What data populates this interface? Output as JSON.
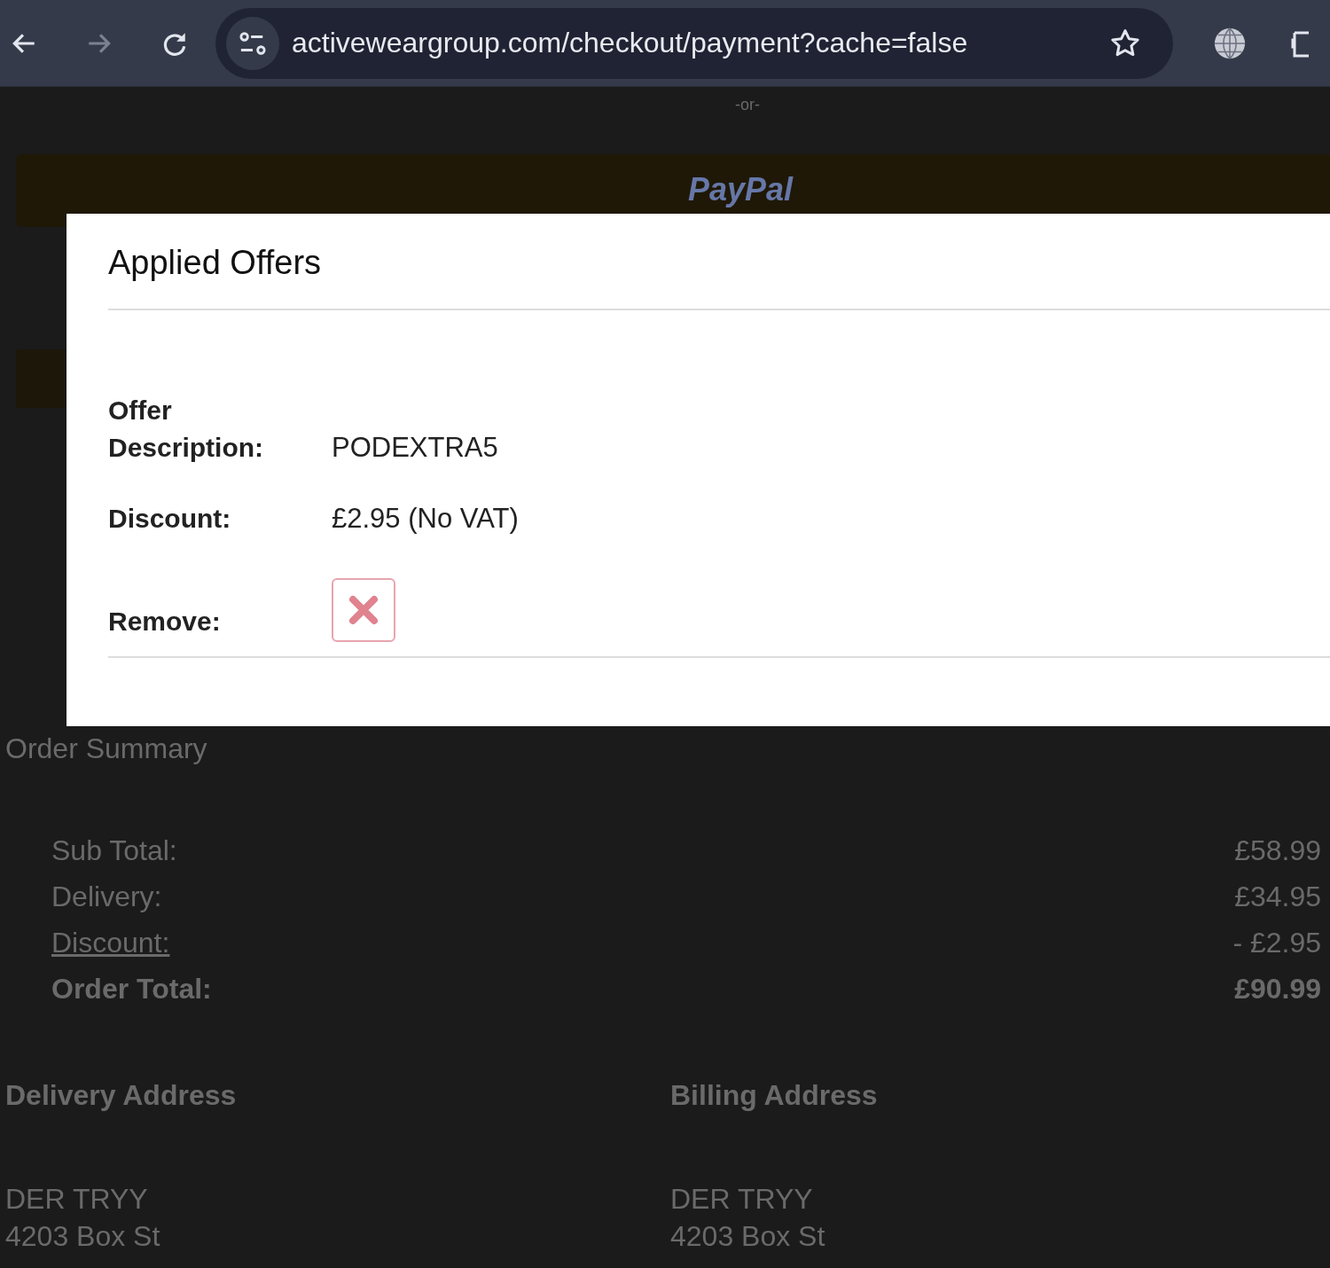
{
  "browser": {
    "url": "activeweargroup.com/checkout/payment?cache=false"
  },
  "page": {
    "separator": "-or-",
    "paypal": "PayPal",
    "order_summary": {
      "title": "Order Summary",
      "rows": [
        {
          "label": "Sub Total:",
          "value": "£58.99",
          "kind": "plain"
        },
        {
          "label": "Delivery:",
          "value": "£34.95",
          "kind": "plain"
        },
        {
          "label": "Discount:",
          "value": "- £2.95",
          "kind": "link"
        },
        {
          "label": "Order Total:",
          "value": "£90.99",
          "kind": "total"
        }
      ]
    },
    "addresses": [
      {
        "title": "Delivery Address",
        "lines": [
          "DER TRYY",
          "4203 Box St"
        ]
      },
      {
        "title": "Billing Address",
        "lines": [
          "DER TRYY",
          "4203 Box St"
        ]
      }
    ]
  },
  "modal": {
    "title": "Applied Offers",
    "fields": [
      {
        "label": "Offer Description:",
        "value": "PODEXTRA5",
        "kind": "text"
      },
      {
        "label": "Discount:",
        "value": "£2.95 (No VAT)",
        "kind": "text"
      },
      {
        "label": "Remove:",
        "kind": "remove"
      }
    ]
  }
}
